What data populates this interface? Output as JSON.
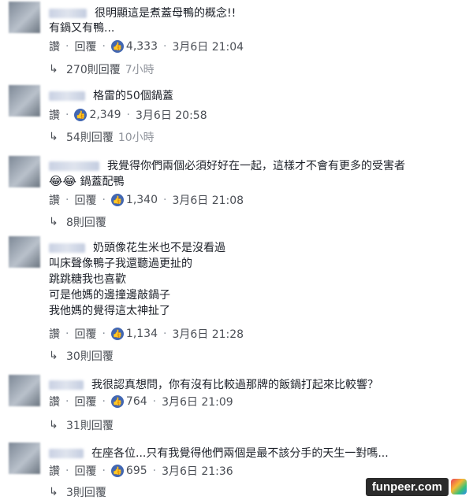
{
  "ui": {
    "like": "讚",
    "reply": "回覆",
    "separator": "·",
    "like_icon": "thumbs-up-icon",
    "reply_icon": "reply-arrow-icon"
  },
  "comments": [
    {
      "lines": [
        "很明顯這是煮蓋母鴨的概念!!",
        "有鍋又有鴨..."
      ],
      "likes": "4,333",
      "time": "3月6日 21:04",
      "replies": "270則回覆",
      "reply_time": "7小時"
    },
    {
      "lines": [
        "格雷的50個鍋蓋"
      ],
      "likes": "2,349",
      "time": "3月6日 20:58",
      "replies": "54則回覆",
      "reply_time": "10小時"
    },
    {
      "lines": [
        "我覺得你們兩個必須好好在一起，這樣才不會有更多的受害者",
        "鍋蓋配鴨"
      ],
      "emoji": "😂😂",
      "likes": "1,340",
      "time": "3月6日 21:08",
      "replies": "8則回覆"
    },
    {
      "lines": [
        "奶頭像花生米也不是沒看過",
        "叫床聲像鴨子我還聽過更扯的",
        "跳跳糖我也喜歡",
        "可是他媽的邊撞邊敲鍋子",
        "我他媽的覺得這太神扯了"
      ],
      "likes": "1,134",
      "time": "3月6日 21:28",
      "replies": "30則回覆"
    },
    {
      "lines": [
        "我很認真想問，你有沒有比較過那牌的飯鍋打起來比較響？"
      ],
      "likes": "764",
      "time": "3月6日 21:09",
      "replies": "31則回覆"
    },
    {
      "lines": [
        "在座各位...只有我覺得他們兩個是最不該分手的天生一對嗎..."
      ],
      "likes": "695",
      "time": "3月6日 21:36",
      "replies": "3則回覆"
    }
  ],
  "watermark": {
    "text": "funpeer.com"
  }
}
